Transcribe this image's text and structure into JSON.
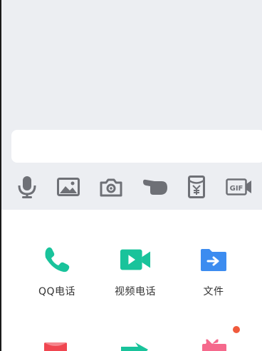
{
  "colors": {
    "background": "#eceef2",
    "icon_gray": "#6e7076",
    "green": "#19c39b",
    "blue": "#3c8cf0",
    "red": "#f04650",
    "pink": "#f5698c",
    "badge": "#f05a3c"
  },
  "toolbar": {
    "items": [
      {
        "icon": "microphone-icon"
      },
      {
        "icon": "image-icon"
      },
      {
        "icon": "camera-icon"
      },
      {
        "icon": "poke-hand-icon"
      },
      {
        "icon": "red-packet-icon"
      },
      {
        "icon": "gif-icon",
        "text": "GIF"
      }
    ]
  },
  "panel": {
    "apps": [
      {
        "icon": "phone-icon",
        "label": "QQ电话"
      },
      {
        "icon": "video-call-icon",
        "label": "视频电话"
      },
      {
        "icon": "file-icon",
        "label": "文件"
      }
    ],
    "row2": [
      {
        "icon": "red-envelope-icon"
      },
      {
        "icon": "share-arrow-icon"
      },
      {
        "icon": "gift-icon",
        "badge": true
      }
    ]
  }
}
